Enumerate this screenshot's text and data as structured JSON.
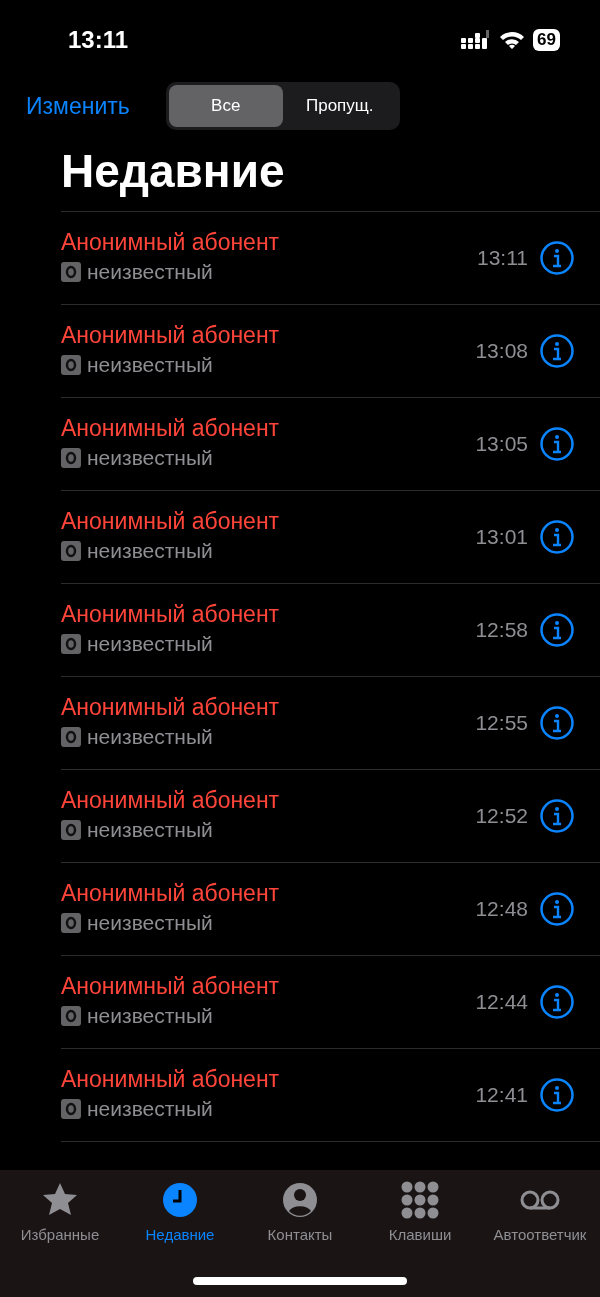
{
  "status_bar": {
    "time": "13:11",
    "battery": "69"
  },
  "edit_button": "Изменить",
  "filter": [
    {
      "label": "Все",
      "selected": true
    },
    {
      "label": "Пропущ.",
      "selected": false
    }
  ],
  "title": "Недавние",
  "calls": [
    {
      "name": "Анонимный абонент",
      "missed": true,
      "type": "неизвестный",
      "time": "13:11"
    },
    {
      "name": "Анонимный абонент",
      "missed": true,
      "type": "неизвестный",
      "time": "13:08"
    },
    {
      "name": "Анонимный абонент",
      "missed": true,
      "type": "неизвестный",
      "time": "13:05"
    },
    {
      "name": "Анонимный абонент",
      "missed": true,
      "type": "неизвестный",
      "time": "13:01"
    },
    {
      "name": "Анонимный абонент",
      "missed": true,
      "type": "неизвестный",
      "time": "12:58"
    },
    {
      "name": "Анонимный абонент",
      "missed": true,
      "type": "неизвестный",
      "time": "12:55"
    },
    {
      "name": "Анонимный абонент",
      "missed": true,
      "type": "неизвестный",
      "time": "12:52"
    },
    {
      "name": "Анонимный абонент",
      "missed": true,
      "type": "неизвестный",
      "time": "12:48"
    },
    {
      "name": "Анонимный абонент",
      "missed": true,
      "type": "неизвестный",
      "time": "12:44"
    },
    {
      "name": "Анонимный абонент",
      "missed": true,
      "type": "неизвестный",
      "time": "12:41"
    }
  ],
  "tab_bar": [
    {
      "kind": "star",
      "label": "Избранные",
      "selected": false
    },
    {
      "kind": "clock",
      "label": "Недавние",
      "selected": true
    },
    {
      "kind": "person",
      "label": "Контакты",
      "selected": false
    },
    {
      "kind": "keypad",
      "label": "Клавиши",
      "selected": false
    },
    {
      "kind": "voicemail",
      "label": "Автоответчик",
      "selected": false
    }
  ]
}
